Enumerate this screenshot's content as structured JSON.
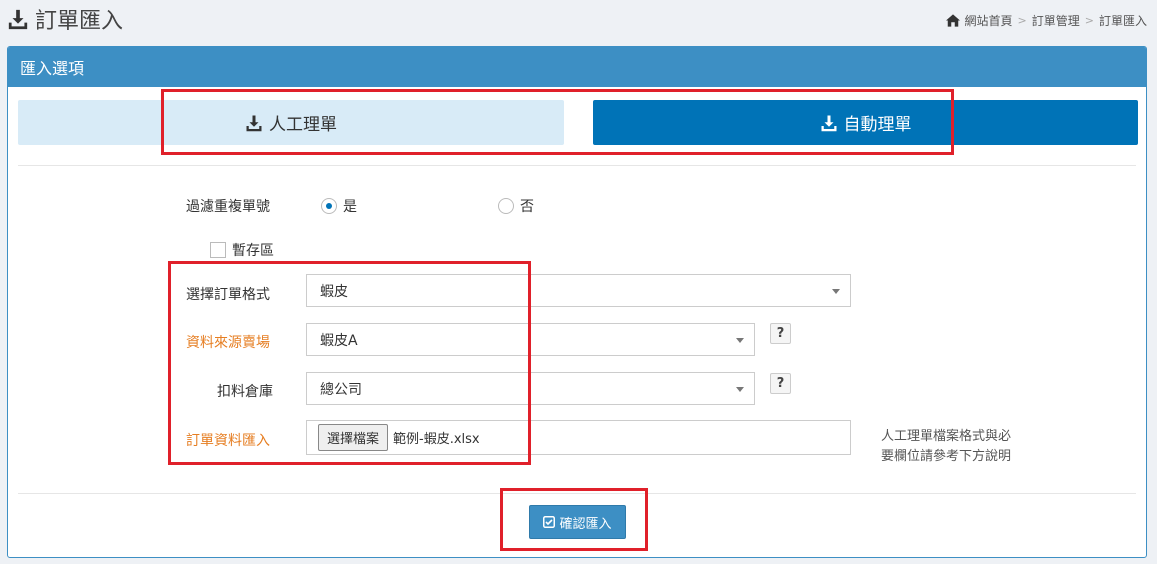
{
  "header": {
    "title": "訂單匯入",
    "breadcrumb": [
      "網站首頁",
      "訂單管理",
      "訂單匯入"
    ]
  },
  "panel": {
    "title": "匯入選項",
    "mode_manual": "人工理單",
    "mode_auto": "自動理單"
  },
  "form": {
    "filter_label": "過濾重複單號",
    "filter_yes": "是",
    "filter_no": "否",
    "filter_selected": "是",
    "temp_label": "暫存區",
    "format_label": "選擇訂單格式",
    "format_value": "蝦皮",
    "source_label": "資料來源賣場",
    "source_value": "蝦皮A",
    "warehouse_label": "扣料倉庫",
    "warehouse_value": "總公司",
    "help_symbol": "?",
    "import_label": "訂單資料匯入",
    "file_button": "選擇檔案",
    "file_name": "範例-蝦皮.xlsx",
    "note_line1": "人工理單檔案格式與必",
    "note_line2": "要欄位請參考下方說明"
  },
  "confirm_label": "確認匯入",
  "colors": {
    "primary": "#3d8fc4",
    "active_button": "#0073b7",
    "inactive_button": "#d8ebf7",
    "required_label": "#e67e22",
    "highlight": "#e0202a"
  }
}
